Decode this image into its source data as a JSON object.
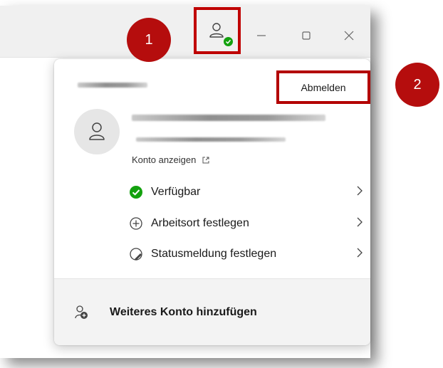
{
  "titlebar": {
    "minimize_glyph": "–",
    "maximize_glyph": "□",
    "close_glyph": "✕"
  },
  "account_menu": {
    "signout_label": "Abmelden",
    "view_account_label": "Konto anzeigen",
    "items": [
      {
        "label": "Verfügbar",
        "icon": "available-check-icon"
      },
      {
        "label": "Arbeitsort festlegen",
        "icon": "location-pin-icon"
      },
      {
        "label": "Statusmeldung festlegen",
        "icon": "status-message-icon"
      }
    ],
    "add_account_label": "Weiteres Konto hinzufügen"
  },
  "annotations": {
    "badge_1": "1",
    "badge_2": "2"
  },
  "colors": {
    "highlight_red": "#c00000",
    "badge_red": "#b50d0d",
    "presence_green": "#13a10e"
  }
}
